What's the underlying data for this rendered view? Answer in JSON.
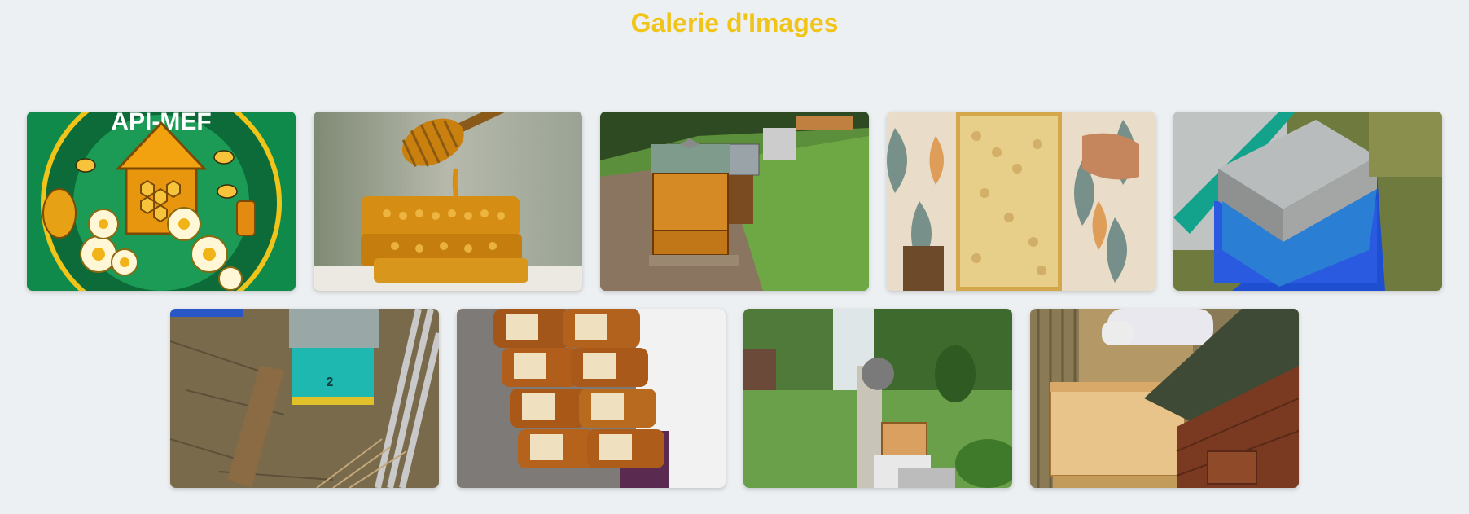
{
  "gallery": {
    "title": "Galerie d'Images",
    "logo_text": "API-MEF",
    "images": [
      {
        "subject": "apiary-logo-badge"
      },
      {
        "subject": "honey-dipper-honeycomb"
      },
      {
        "subject": "beehives-on-pallets"
      },
      {
        "subject": "honeycomb-frame"
      },
      {
        "subject": "hive-on-blue-pallet"
      },
      {
        "subject": "small-blue-hive-numbered",
        "hive_number": "2"
      },
      {
        "subject": "honey-jars"
      },
      {
        "subject": "beekeeper-in-garden"
      },
      {
        "subject": "wooden-hive-with-roof"
      }
    ]
  },
  "colors": {
    "title": "#f0c419",
    "background": "#edf0f2",
    "logo_green": "#0f8a4a",
    "honey": "#d98e12"
  }
}
